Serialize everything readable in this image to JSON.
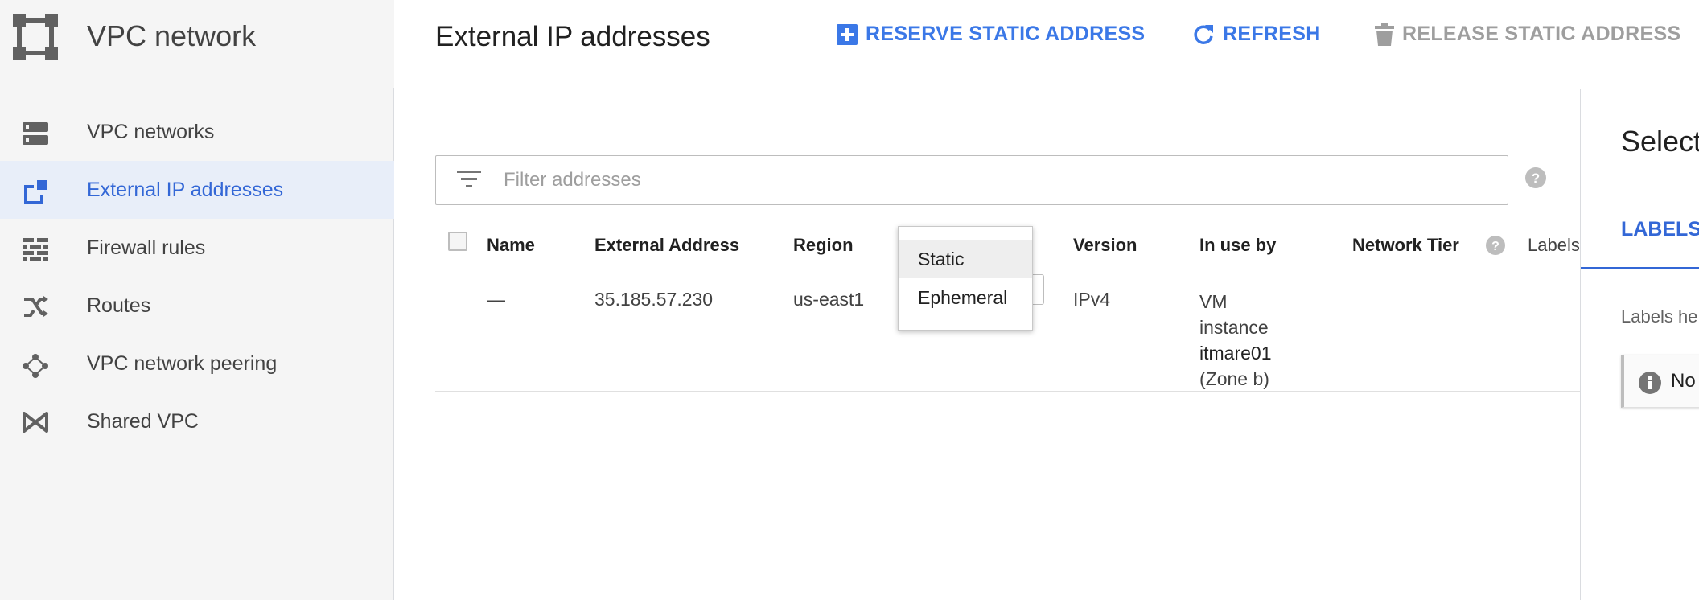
{
  "app": {
    "title": "VPC network",
    "icon": "vpc-network-icon"
  },
  "sidebar": {
    "items": [
      {
        "label": "VPC networks",
        "icon": "vpc-networks-icon",
        "active": false
      },
      {
        "label": "External IP addresses",
        "icon": "external-ip-icon",
        "active": true
      },
      {
        "label": "Firewall rules",
        "icon": "firewall-icon",
        "active": false
      },
      {
        "label": "Routes",
        "icon": "routes-icon",
        "active": false
      },
      {
        "label": "VPC network peering",
        "icon": "peering-icon",
        "active": false
      },
      {
        "label": "Shared VPC",
        "icon": "shared-vpc-icon",
        "active": false
      }
    ]
  },
  "header": {
    "title": "External IP addresses",
    "reserve_label": "RESERVE STATIC ADDRESS",
    "refresh_label": "REFRESH",
    "release_label": "RELEASE STATIC ADDRESS"
  },
  "filter": {
    "placeholder": "Filter addresses"
  },
  "table": {
    "columns": {
      "name": "Name",
      "external_address": "External Address",
      "region": "Region",
      "version": "Version",
      "in_use_by": "In use by",
      "network_tier": "Network Tier",
      "labels": "Labels"
    },
    "rows": [
      {
        "name": "—",
        "external_address": "35.185.57.230",
        "region": "us-east1",
        "version": "IPv4",
        "in_use_line1": "VM",
        "in_use_line2": "instance",
        "in_use_link": "itmare01",
        "in_use_zone": "(Zone b)"
      }
    ]
  },
  "type_dropdown": {
    "options": [
      "Static",
      "Ephemeral"
    ],
    "highlighted": "Static"
  },
  "panel": {
    "title": "Select",
    "tab": "LABELS",
    "hint": "Labels he",
    "note": "No"
  },
  "colors": {
    "accent": "#3b78e7",
    "active_bg": "#e8eef9",
    "disabled": "#9e9e9e"
  }
}
